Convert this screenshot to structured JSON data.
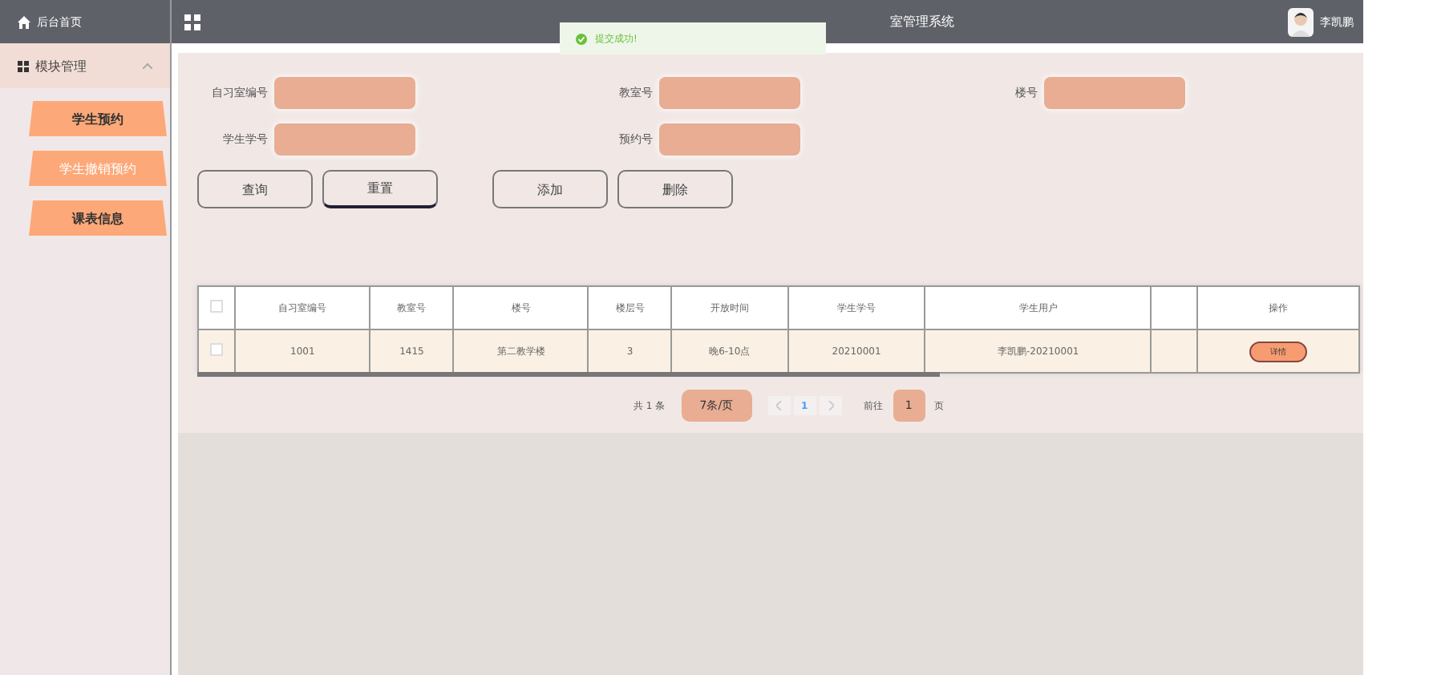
{
  "sidebar": {
    "home": "后台首页",
    "group": {
      "label": "模块管理",
      "expanded": true
    },
    "items": [
      {
        "label": "学生预约",
        "selected": false
      },
      {
        "label": "学生撤销预约",
        "selected": true
      },
      {
        "label": "课表信息",
        "selected": false
      }
    ]
  },
  "header": {
    "title": "室管理系统",
    "user": "李凯鹏"
  },
  "toast": {
    "message": "提交成功!"
  },
  "search_fields": [
    {
      "label": "自习室编号"
    },
    {
      "label": "教室号"
    },
    {
      "label": "楼号"
    },
    {
      "label": "学生学号"
    },
    {
      "label": "预约号"
    }
  ],
  "buttons": [
    "查询",
    "重置",
    "添加",
    "删除"
  ],
  "table": {
    "all_checked": false,
    "columns": [
      "自习室编号",
      "教室号",
      "楼号",
      "楼层号",
      "开放时间",
      "学生学号",
      "学生用户",
      "操作"
    ],
    "rows": [
      {
        "checked": false,
        "cells": [
          "1001",
          "1415",
          "第二教学楼",
          "3",
          "晚6-10点",
          "20210001",
          "李凯鹏-20210001"
        ],
        "action": "详情"
      }
    ]
  },
  "pagination": {
    "total": "共 1 条",
    "page_size": "7条/页",
    "pages": [
      "1"
    ],
    "goto_label": "前往",
    "goto_value": "1",
    "goto_unit": "页"
  }
}
